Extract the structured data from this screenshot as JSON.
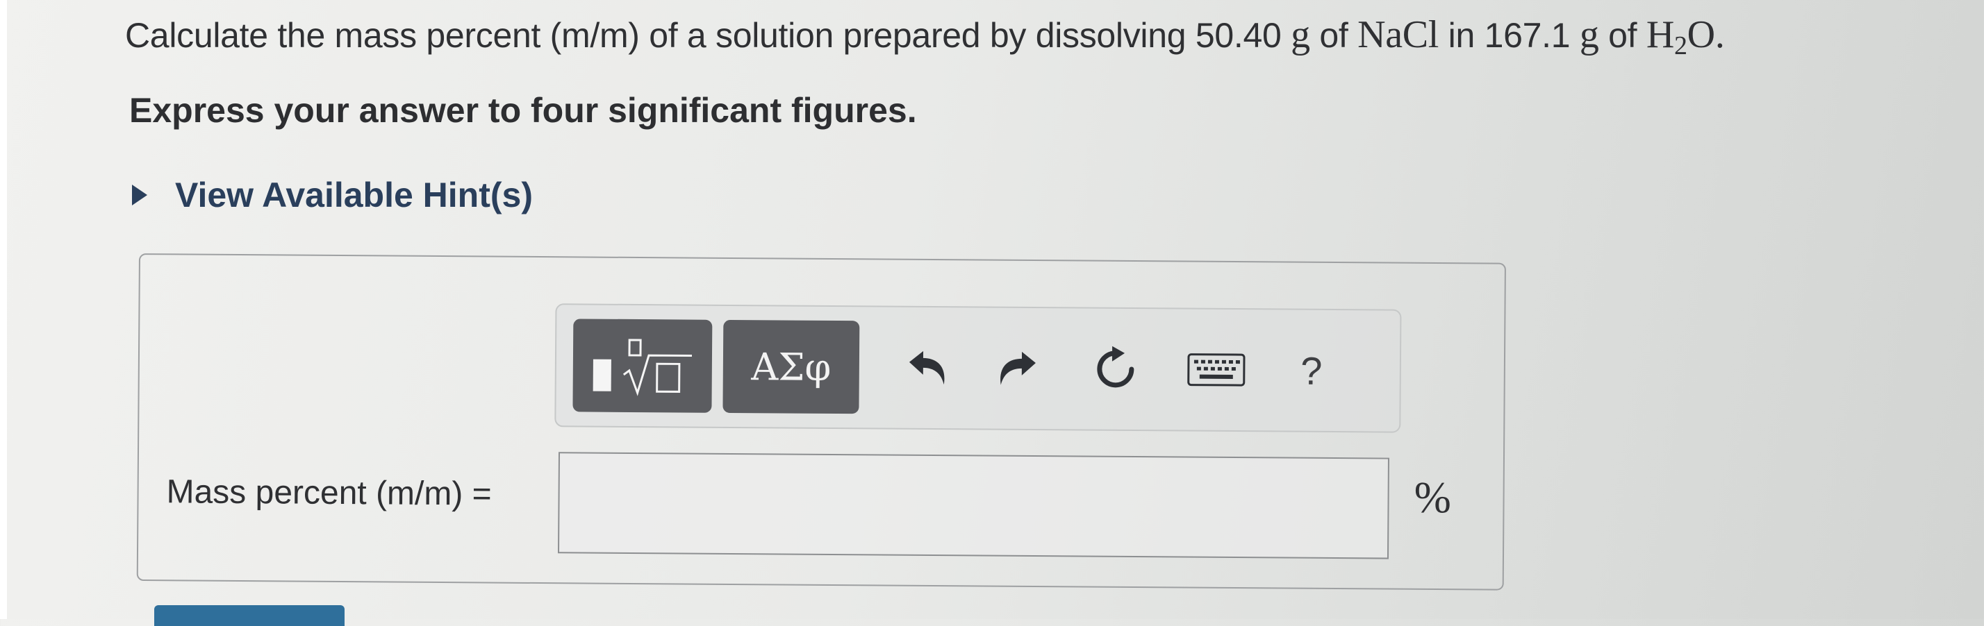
{
  "question": {
    "prefix": "Calculate the mass percent (m/m) of a solution prepared by dissolving",
    "mass1": "50.40",
    "unit1": "g",
    "of1": "of",
    "solute": "NaCl",
    "in": "in",
    "mass2": "167.1",
    "unit2": "g",
    "of2": "of",
    "solvent_main": "H",
    "solvent_sub": "2",
    "solvent_end": "O",
    "period": "."
  },
  "instruction": "Express your answer to four significant figures.",
  "hint_toggle": {
    "label": "View Available Hint(s)",
    "icon": "caret-right-icon"
  },
  "toolbar": {
    "templates_icon": "templates-sqrt-icon",
    "greek_label": "ΑΣφ",
    "undo_icon": "undo-icon",
    "redo_icon": "redo-icon",
    "reset_icon": "reset-icon",
    "keyboard_icon": "keyboard-icon",
    "help_label": "?"
  },
  "answer": {
    "label": "Mass percent (m/m) =",
    "value": "",
    "unit": "%"
  },
  "colors": {
    "hint_text": "#2a3f5c",
    "toolbar_button": "#5b5c60",
    "submit_button": "#2f6f9b"
  }
}
